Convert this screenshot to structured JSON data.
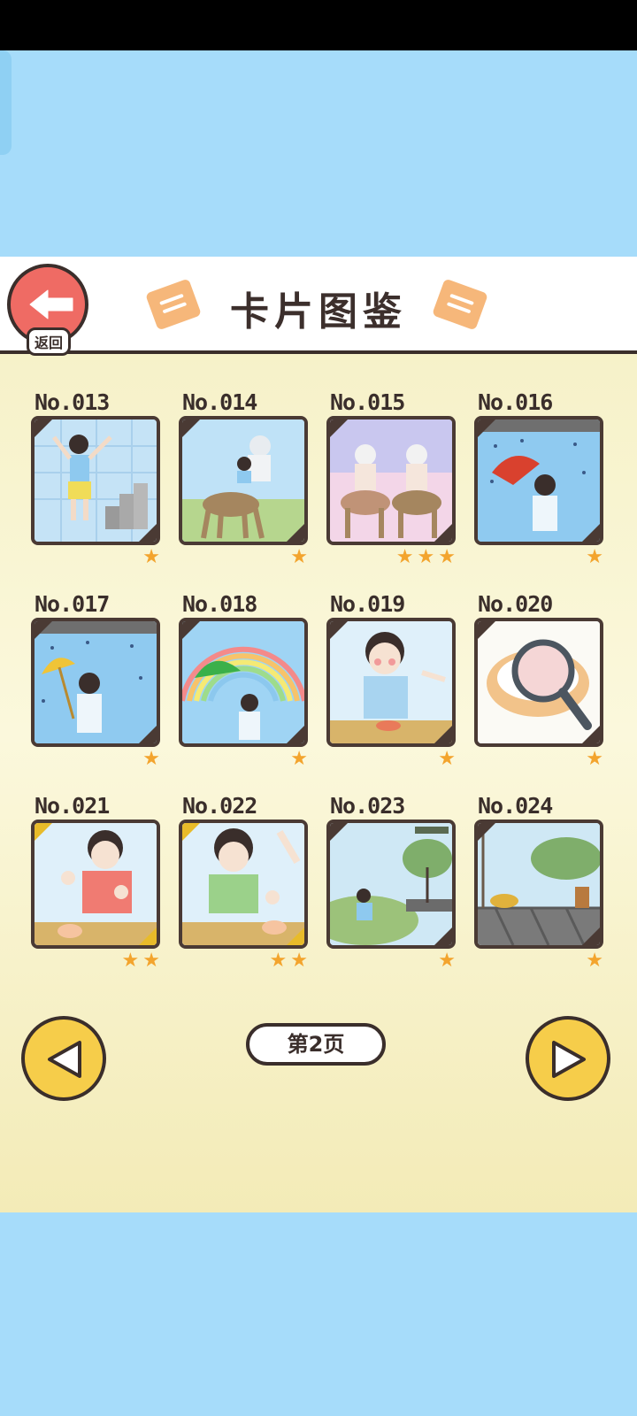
{
  "header": {
    "title": "卡片图鉴",
    "back_label": "返回"
  },
  "cards": [
    {
      "no": "No.013",
      "stars": 1
    },
    {
      "no": "No.014",
      "stars": 1
    },
    {
      "no": "No.015",
      "stars": 3
    },
    {
      "no": "No.016",
      "stars": 1
    },
    {
      "no": "No.017",
      "stars": 1
    },
    {
      "no": "No.018",
      "stars": 1
    },
    {
      "no": "No.019",
      "stars": 1
    },
    {
      "no": "No.020",
      "stars": 1
    },
    {
      "no": "No.021",
      "stars": 2
    },
    {
      "no": "No.022",
      "stars": 2
    },
    {
      "no": "No.023",
      "stars": 1
    },
    {
      "no": "No.024",
      "stars": 1
    }
  ],
  "pagination": {
    "page_label": "第2页"
  },
  "colors": {
    "sky": "#a6dcfa",
    "panel": "#f7f2cb",
    "star": "#f3a42d",
    "accent_red": "#ef6b64",
    "nav_yellow": "#f6cd4a",
    "gold_corner": "#e8bb2a"
  }
}
